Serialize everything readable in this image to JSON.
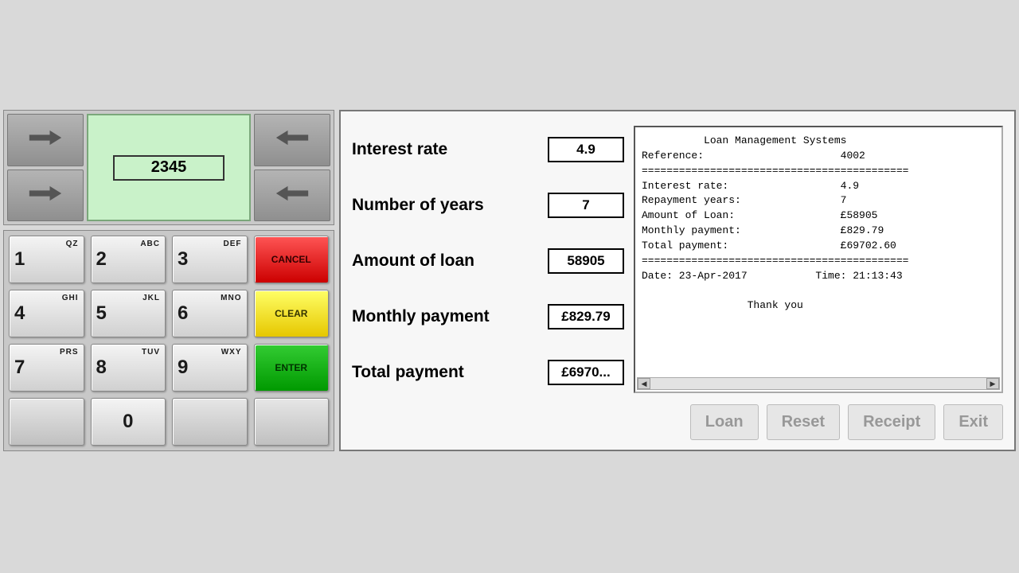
{
  "atm": {
    "screen_value": "2345",
    "keys": [
      {
        "num": "1",
        "alpha": "QZ"
      },
      {
        "num": "2",
        "alpha": "ABC"
      },
      {
        "num": "3",
        "alpha": "DEF"
      },
      {
        "num": "4",
        "alpha": "GHI"
      },
      {
        "num": "5",
        "alpha": "JKL"
      },
      {
        "num": "6",
        "alpha": "MNO"
      },
      {
        "num": "7",
        "alpha": "PRS"
      },
      {
        "num": "8",
        "alpha": "TUV"
      },
      {
        "num": "9",
        "alpha": "WXY"
      },
      {
        "num": "0",
        "alpha": ""
      }
    ],
    "cancel_label": "CANCEL",
    "clear_label": "CLEAR",
    "enter_label": "ENTER"
  },
  "form": {
    "interest_rate": {
      "label": "Interest rate",
      "value": "4.9"
    },
    "years": {
      "label": "Number of years",
      "value": "7"
    },
    "amount": {
      "label": "Amount  of loan",
      "value": "58905"
    },
    "monthly": {
      "label": "Monthly payment",
      "value": "£829.79"
    },
    "total": {
      "label": "Total payment",
      "value": "£6970..."
    }
  },
  "receipt": {
    "title": "Loan Management Systems",
    "reference_label": "Reference:",
    "reference_value": "4002",
    "rule": "===========================================",
    "rows": [
      {
        "label": "Interest rate:",
        "value": "4.9"
      },
      {
        "label": "Repayment years:",
        "value": "7"
      },
      {
        "label": "Amount of Loan:",
        "value": "£58905"
      },
      {
        "label": "Monthly payment:",
        "value": "£829.79"
      },
      {
        "label": "Total payment:",
        "value": "£69702.60"
      }
    ],
    "date_label": "Date:",
    "date_value": "23-Apr-2017",
    "time_label": "Time:",
    "time_value": "21:13:43",
    "thanks": "Thank you"
  },
  "actions": {
    "loan": "Loan",
    "reset": "Reset",
    "receipt": "Receipt",
    "exit": "Exit"
  }
}
